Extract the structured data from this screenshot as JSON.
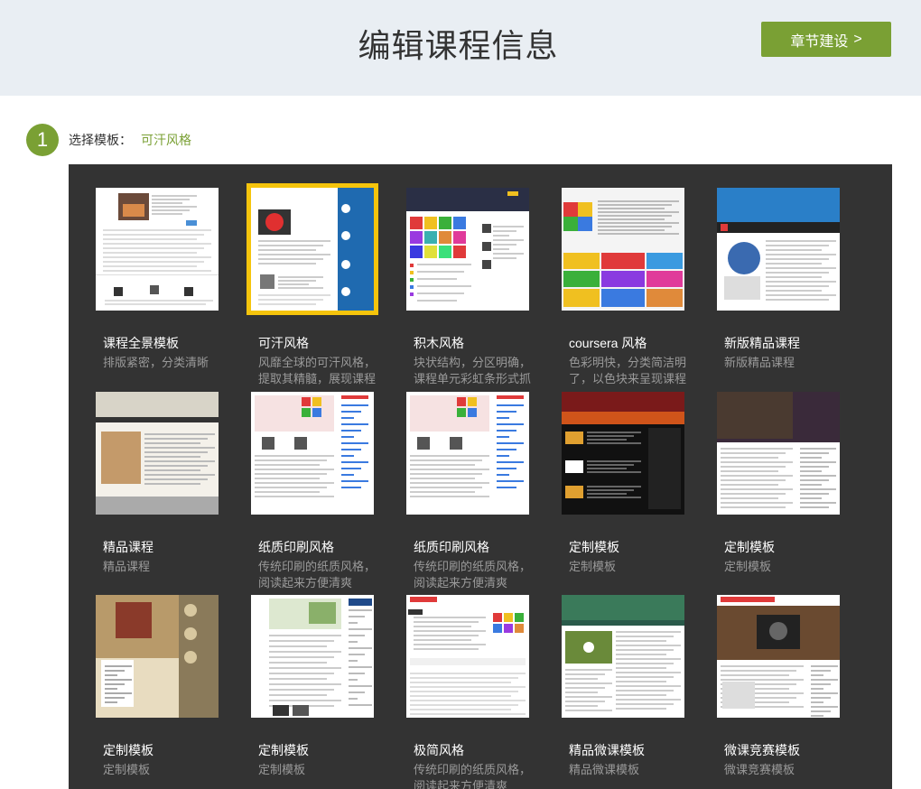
{
  "header": {
    "title": "编辑课程信息",
    "next_button": "章节建设",
    "next_chevron": ">"
  },
  "step": {
    "number": "1",
    "label": "选择模板：",
    "selected_value": "可汗风格"
  },
  "colors": {
    "accent": "#7aa034",
    "selected_border": "#f5c40c",
    "panel_bg": "#333333",
    "header_bg": "#e9eef3"
  },
  "templates": [
    {
      "name": "课程全景模板",
      "desc": "排版紧密，分类清晰",
      "thumb": "panorama"
    },
    {
      "name": "可汗风格",
      "desc": "风靡全球的可汗风格，提取其精髓，展现课程主页",
      "thumb": "khan",
      "selected": true
    },
    {
      "name": "积木风格",
      "desc": "块状结构，分区明确，课程单元彩虹条形式抓人眼球",
      "thumb": "blocks"
    },
    {
      "name": "coursera 风格",
      "desc": "色彩明快，分类简洁明了，以色块来呈现课程单元",
      "thumb": "coursera"
    },
    {
      "name": "新版精品课程",
      "desc": "新版精品课程",
      "thumb": "newpremium"
    },
    {
      "name": "精品课程",
      "desc": "精品课程",
      "thumb": "chinese-lit"
    },
    {
      "name": "纸质印刷风格",
      "desc": "传统印刷的纸质风格，阅读起来方便清爽",
      "thumb": "paper"
    },
    {
      "name": "纸质印刷风格",
      "desc": "传统印刷的纸质风格，阅读起来方便清爽",
      "thumb": "paper"
    },
    {
      "name": "定制模板",
      "desc": "定制模板",
      "thumb": "dark-orange"
    },
    {
      "name": "定制模板",
      "desc": "定制模板",
      "thumb": "dark-photo"
    },
    {
      "name": "定制模板",
      "desc": "定制模板",
      "thumb": "ancient"
    },
    {
      "name": "定制模板",
      "desc": "定制模板",
      "thumb": "plain-blue"
    },
    {
      "name": "极简风格",
      "desc": "传统印刷的纸质风格，阅读起来方便清爽",
      "thumb": "minimal"
    },
    {
      "name": "精品微课模板",
      "desc": "精品微课模板",
      "thumb": "micro"
    },
    {
      "name": "微课竞赛模板",
      "desc": "微课竞赛模板",
      "thumb": "contest"
    }
  ]
}
